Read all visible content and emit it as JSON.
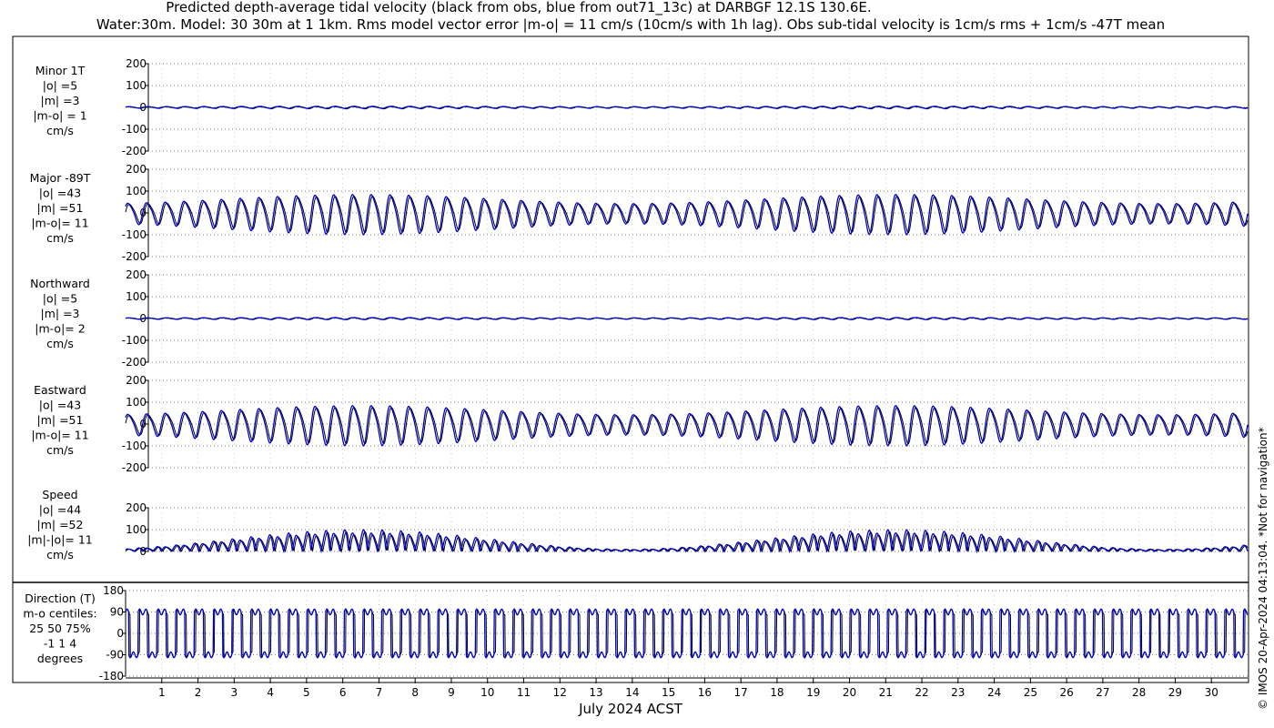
{
  "header": {
    "title_line1": "Predicted depth-average tidal velocity (black from obs, blue from out71_13c) at DARBGF 12.1S 130.6E.",
    "title_line2": "Water:30m. Model: 30 30m at 1 1km. Rms model vector error |m-o| = 11 cm/s (10cm/s with 1h lag). Obs sub-tidal velocity is 1cm/s rms + 1cm/s -47T mean"
  },
  "credit": "© IMOS 20-Apr-2024 04:13:04. *Not for navigation*",
  "x_axis": {
    "label": "July 2024 ACST",
    "tick_labels": [
      "1",
      "2",
      "3",
      "4",
      "5",
      "6",
      "7",
      "8",
      "9",
      "10",
      "11",
      "12",
      "13",
      "14",
      "15",
      "16",
      "17",
      "18",
      "19",
      "20",
      "21",
      "22",
      "23",
      "24",
      "25",
      "26",
      "27",
      "28",
      "29",
      "30"
    ],
    "day_start": 0,
    "day_end": 31
  },
  "colors": {
    "obs": "#000000",
    "model": "#0000cc",
    "grid": "#555555",
    "axis": "#000000"
  },
  "chart_data": [
    {
      "type": "line",
      "name": "minor",
      "side_label": [
        "Minor 1T",
        "|o| =5",
        "|m| =3",
        "|m-o| = 1",
        "cm/s"
      ],
      "ylim": [
        -200,
        200
      ],
      "yticks": [
        -200,
        -100,
        0,
        100,
        200
      ],
      "series": [
        {
          "name": "obs",
          "amplitude": 6,
          "beat_depth": 0.4
        },
        {
          "name": "model",
          "amplitude": 4,
          "beat_depth": 0.4
        }
      ]
    },
    {
      "type": "line",
      "name": "major",
      "side_label": [
        "Major -89T",
        "|o| =43",
        "|m| =51",
        "|m-o|= 11",
        "cm/s"
      ],
      "ylim": [
        -200,
        200
      ],
      "yticks": [
        -200,
        -100,
        0,
        100,
        200
      ],
      "series": [
        {
          "name": "obs",
          "amplitude": 80,
          "beat_depth": 0.55
        },
        {
          "name": "model",
          "amplitude": 88,
          "beat_depth": 0.55
        }
      ]
    },
    {
      "type": "line",
      "name": "northward",
      "side_label": [
        "Northward",
        "|o| =5",
        "|m| =3",
        "|m-o|= 2",
        "cm/s"
      ],
      "ylim": [
        -200,
        200
      ],
      "yticks": [
        -200,
        -100,
        0,
        100,
        200
      ],
      "series": [
        {
          "name": "obs",
          "amplitude": 5,
          "beat_depth": 0.4
        },
        {
          "name": "model",
          "amplitude": 4,
          "beat_depth": 0.4
        }
      ]
    },
    {
      "type": "line",
      "name": "eastward",
      "side_label": [
        "Eastward",
        "|o| =43",
        "|m| =51",
        "|m-o|= 11",
        "cm/s"
      ],
      "ylim": [
        -200,
        200
      ],
      "yticks": [
        -200,
        -100,
        0,
        100,
        200
      ],
      "series": [
        {
          "name": "obs",
          "amplitude": 80,
          "beat_depth": 0.55
        },
        {
          "name": "model",
          "amplitude": 88,
          "beat_depth": 0.55
        }
      ]
    },
    {
      "type": "line",
      "name": "speed",
      "side_label": [
        "Speed",
        "|o| =44",
        "|m| =52",
        "|m|-|o|= 11",
        "cm/s"
      ],
      "ylim": [
        0,
        200
      ],
      "yticks": [
        0,
        100,
        200
      ],
      "series": [
        {
          "name": "obs",
          "amplitude": 80,
          "beat_depth": 0.55
        },
        {
          "name": "model",
          "amplitude": 88,
          "beat_depth": 0.55
        }
      ]
    },
    {
      "type": "line",
      "name": "direction",
      "side_label": [
        "Direction (T)",
        "m-o centiles:",
        "25  50  75%",
        "-1  1  4",
        "degrees"
      ],
      "ylim": [
        -180,
        180
      ],
      "yticks": [
        -180,
        -90,
        0,
        90,
        180
      ],
      "series": [
        {
          "name": "obs"
        },
        {
          "name": "model"
        }
      ]
    }
  ]
}
